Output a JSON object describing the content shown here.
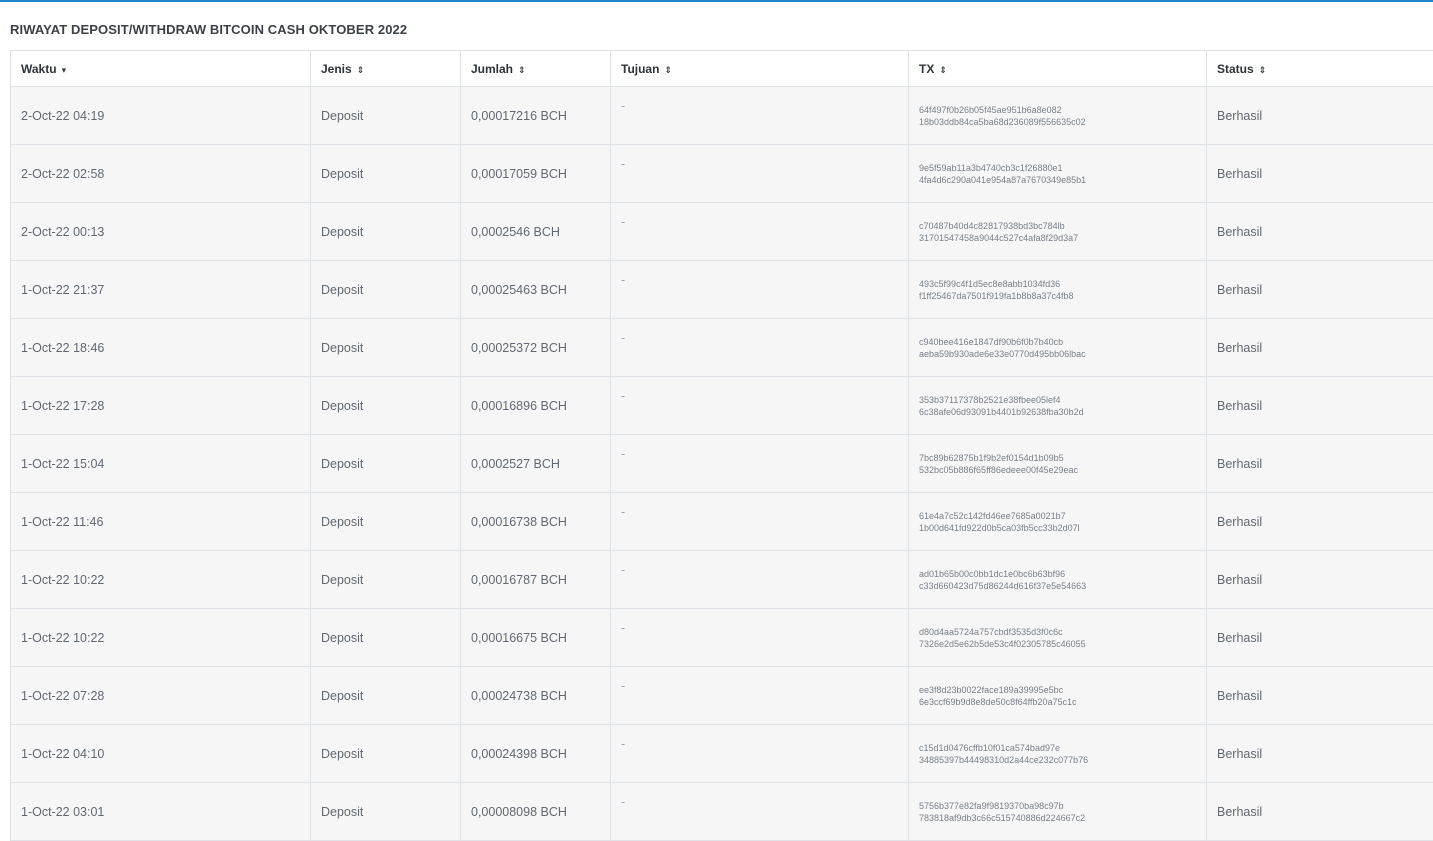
{
  "page": {
    "title": "RIWAYAT DEPOSIT/WITHDRAW BITCOIN CASH OKTOBER 2022"
  },
  "table": {
    "columns": [
      {
        "label": "Waktu",
        "sort": "▾"
      },
      {
        "label": "Jenis",
        "sort": "⇕"
      },
      {
        "label": "Jumlah",
        "sort": "⇕"
      },
      {
        "label": "Tujuan",
        "sort": "⇕"
      },
      {
        "label": "TX",
        "sort": "⇕"
      },
      {
        "label": "Status",
        "sort": "⇕"
      }
    ],
    "rows": [
      {
        "waktu": "2-Oct-22 04:19",
        "jenis": "Deposit",
        "jumlah": "0,00017216 BCH",
        "tujuan": "-",
        "tx1": "64f497f0b26b05f45ae951b6a8e082",
        "tx2": "18b03ddb84ca5ba68d236089f556635c02",
        "status": "Berhasil"
      },
      {
        "waktu": "2-Oct-22 02:58",
        "jenis": "Deposit",
        "jumlah": "0,00017059 BCH",
        "tujuan": "-",
        "tx1": "9e5f59ab11a3b4740cb3c1f26880e1",
        "tx2": "4fa4d6c290a041e954a87a7670349e85b1",
        "status": "Berhasil"
      },
      {
        "waktu": "2-Oct-22 00:13",
        "jenis": "Deposit",
        "jumlah": "0,0002546 BCH",
        "tujuan": "-",
        "tx1": "c70487b40d4c82817938bd3bc784lb",
        "tx2": "31701547458a9044c527c4afa8f29d3a7",
        "status": "Berhasil"
      },
      {
        "waktu": "1-Oct-22 21:37",
        "jenis": "Deposit",
        "jumlah": "0,00025463 BCH",
        "tujuan": "-",
        "tx1": "493c5f99c4f1d5ec8e8abb1034fd36",
        "tx2": "f1ff25467da7501f919fa1b8b8a37c4fb8",
        "status": "Berhasil"
      },
      {
        "waktu": "1-Oct-22 18:46",
        "jenis": "Deposit",
        "jumlah": "0,00025372 BCH",
        "tujuan": "-",
        "tx1": "c940bee416e1847df90b6f0b7b40cb",
        "tx2": "aeba59b930ade6e33e0770d495bb06lbac",
        "status": "Berhasil"
      },
      {
        "waktu": "1-Oct-22 17:28",
        "jenis": "Deposit",
        "jumlah": "0,00016896 BCH",
        "tujuan": "-",
        "tx1": "353b37117378b2521e38fbee05lef4",
        "tx2": "6c38afe06d93091b4401b92638fba30b2d",
        "status": "Berhasil"
      },
      {
        "waktu": "1-Oct-22 15:04",
        "jenis": "Deposit",
        "jumlah": "0,0002527 BCH",
        "tujuan": "-",
        "tx1": "7bc89b62875b1f9b2ef0154d1b09b5",
        "tx2": "532bc05b886f65ff86edeee00f45e29eac",
        "status": "Berhasil"
      },
      {
        "waktu": "1-Oct-22 11:46",
        "jenis": "Deposit",
        "jumlah": "0,00016738 BCH",
        "tujuan": "-",
        "tx1": "61e4a7c52c142fd46ee7685a0021b7",
        "tx2": "1b00d641fd922d0b5ca03fb5cc33b2d07l",
        "status": "Berhasil"
      },
      {
        "waktu": "1-Oct-22 10:22",
        "jenis": "Deposit",
        "jumlah": "0,00016787 BCH",
        "tujuan": "-",
        "tx1": "ad01b65b00c0bb1dc1e0bc6b63bf96",
        "tx2": "c33d660423d75d86244d616f37e5e54663",
        "status": "Berhasil"
      },
      {
        "waktu": "1-Oct-22 10:22",
        "jenis": "Deposit",
        "jumlah": "0,00016675 BCH",
        "tujuan": "-",
        "tx1": "d80d4aa5724a757cbdf3535d3f0c6c",
        "tx2": "7326e2d5e62b5de53c4f02305785c46055",
        "status": "Berhasil"
      },
      {
        "waktu": "1-Oct-22 07:28",
        "jenis": "Deposit",
        "jumlah": "0,00024738 BCH",
        "tujuan": "-",
        "tx1": "ee3f8d23b0022face189a39995e5bc",
        "tx2": "6e3ccf69b9d8e8de50c8f64ffb20a75c1c",
        "status": "Berhasil"
      },
      {
        "waktu": "1-Oct-22 04:10",
        "jenis": "Deposit",
        "jumlah": "0,00024398 BCH",
        "tujuan": "-",
        "tx1": "c15d1d0476cffb10f01ca574bad97e",
        "tx2": "34885397b44498310d2a44ce232c077b76",
        "status": "Berhasil"
      },
      {
        "waktu": "1-Oct-22 03:01",
        "jenis": "Deposit",
        "jumlah": "0,00008098 BCH",
        "tujuan": "-",
        "tx1": "5756b377e82fa9f9819370ba98c97b",
        "tx2": "783818af9db3c66c515740886d224667c2",
        "status": "Berhasil"
      }
    ]
  }
}
